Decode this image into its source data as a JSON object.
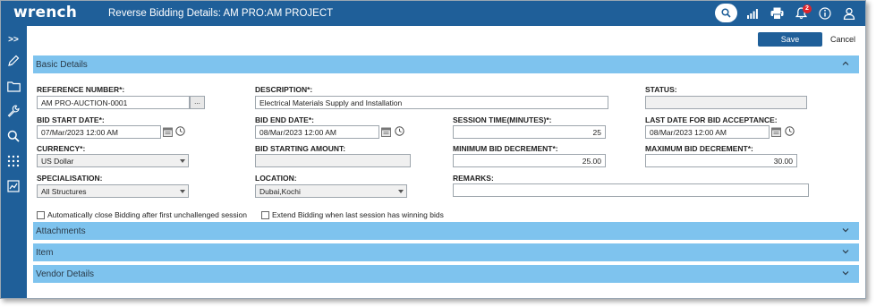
{
  "app": {
    "logo": "wrench",
    "title": "Reverse Bidding Details: AM PRO:AM PROJECT",
    "notification_count": "2",
    "accent": "#1f5f99",
    "section_color": "#7ec3ee"
  },
  "topbar_icons": [
    "search-icon",
    "signal-bars-icon",
    "printer-icon",
    "bell-icon",
    "info-icon",
    "user-icon"
  ],
  "sidebar": {
    "expand_label": ">>",
    "icons": [
      "pencil-icon",
      "folder-icon",
      "wrench-icon",
      "search-icon",
      "apps-grid-icon",
      "chart-icon"
    ]
  },
  "actions": {
    "save": "Save",
    "cancel": "Cancel"
  },
  "sections": {
    "basic": "Basic Details",
    "attachments": "Attachments",
    "item": "Item",
    "vendor": "Vendor Details"
  },
  "fields": {
    "reference_number": {
      "label": "REFERENCE NUMBER*:",
      "value": "AM PRO-AUCTION-0001",
      "browse": "..."
    },
    "description": {
      "label": "DESCRIPTION*:",
      "value": "Electrical Materials Supply and Installation"
    },
    "status": {
      "label": "STATUS:",
      "value": ""
    },
    "bid_start_date": {
      "label": "BID START DATE*:",
      "value": "07/Mar/2023 12:00 AM"
    },
    "bid_end_date": {
      "label": "BID END DATE*:",
      "value": "08/Mar/2023 12:00 AM"
    },
    "session_time": {
      "label": "SESSION TIME(MINUTES)*:",
      "value": "25"
    },
    "last_date": {
      "label": "LAST DATE FOR BID ACCEPTANCE:",
      "value": "08/Mar/2023 12:00 AM"
    },
    "currency": {
      "label": "CURRENCY*:",
      "value": "US Dollar"
    },
    "bid_starting_amount": {
      "label": "BID STARTING AMOUNT:",
      "value": ""
    },
    "min_bid_decrement": {
      "label": "MINIMUM BID DECREMENT*:",
      "value": "25.00"
    },
    "max_bid_decrement": {
      "label": "MAXIMUM BID DECREMENT*:",
      "value": "30.00"
    },
    "specialisation": {
      "label": "SPECIALISATION:",
      "value": "All Structures"
    },
    "location": {
      "label": "LOCATION:",
      "value": "Dubai,Kochi"
    },
    "remarks": {
      "label": "REMARKS:",
      "value": ""
    }
  },
  "checkboxes": {
    "auto_close": {
      "label": "Automatically close Bidding after first unchallenged session",
      "checked": false
    },
    "extend": {
      "label": "Extend Bidding when last session has winning bids",
      "checked": false
    }
  }
}
